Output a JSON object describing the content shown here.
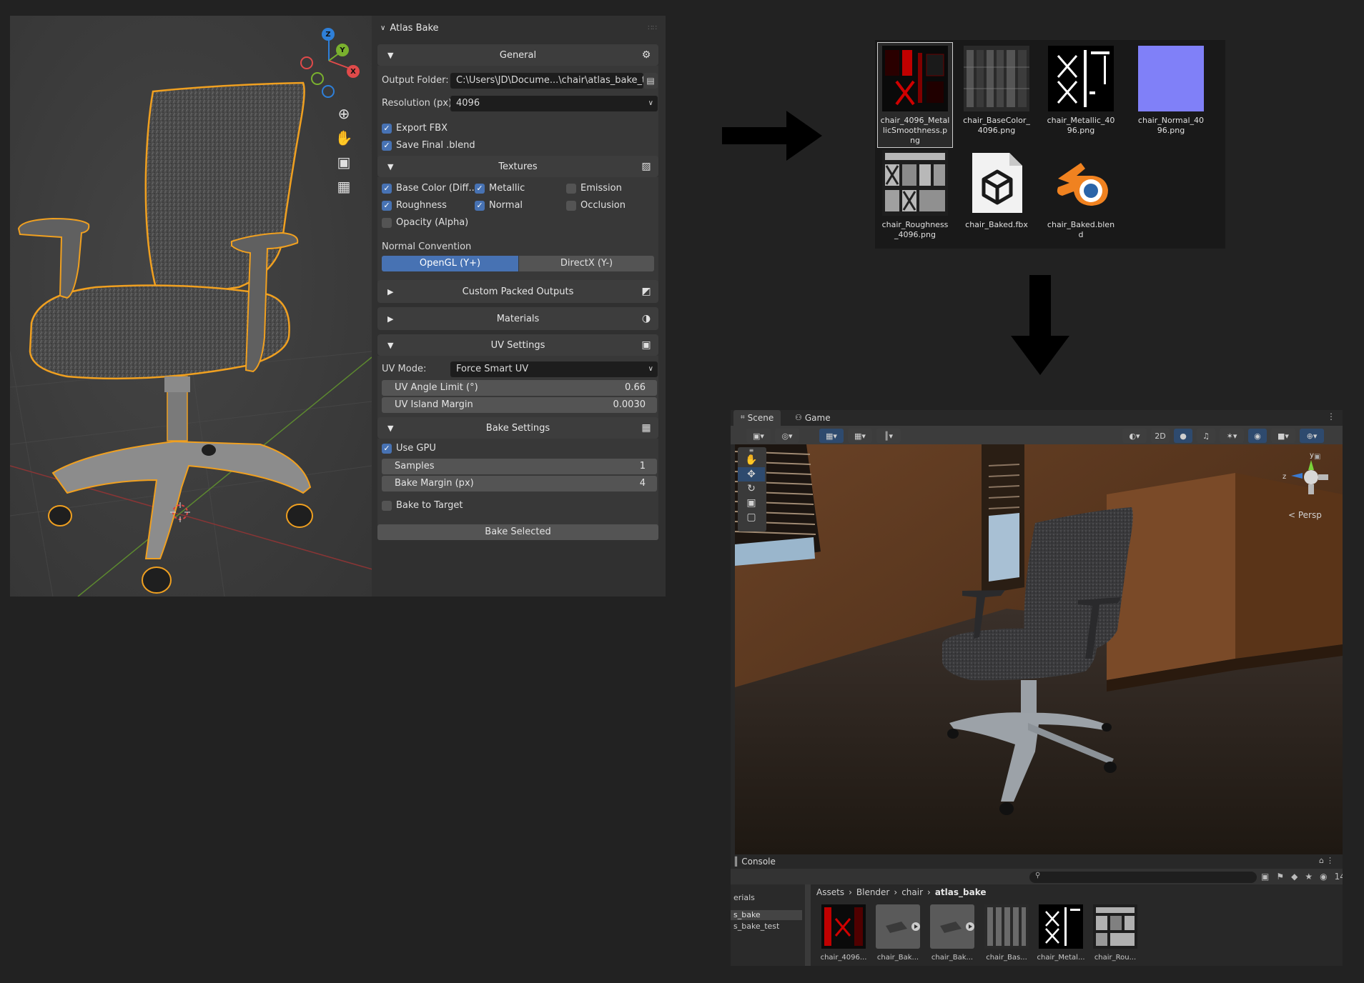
{
  "blender": {
    "panel_title": "Atlas Bake",
    "general": {
      "title": "General",
      "output_folder_label": "Output Folder:",
      "output_folder_value": "C:\\Users\\JD\\Docume...\\chair\\atlas_bake_test",
      "resolution_label": "Resolution (px):",
      "resolution_value": "4096",
      "export_fbx": "Export FBX",
      "save_final": "Save Final .blend"
    },
    "textures": {
      "title": "Textures",
      "base_color": "Base Color (Diff...",
      "metallic": "Metallic",
      "emission": "Emission",
      "roughness": "Roughness",
      "normal": "Normal",
      "occlusion": "Occlusion",
      "opacity": "Opacity (Alpha)",
      "normal_convention_label": "Normal Convention",
      "opengl": "OpenGL (Y+)",
      "directx": "DirectX (Y-)"
    },
    "custom_packed": "Custom Packed Outputs",
    "materials": "Materials",
    "uv": {
      "title": "UV Settings",
      "mode_label": "UV Mode:",
      "mode_value": "Force Smart UV",
      "angle_label": "UV Angle Limit (°)",
      "angle_value": "0.66",
      "margin_label": "UV Island Margin",
      "margin_value": "0.0030"
    },
    "bake": {
      "title": "Bake Settings",
      "use_gpu": "Use GPU",
      "samples_label": "Samples",
      "samples_value": "1",
      "margin_label": "Bake Margin (px)",
      "margin_value": "4",
      "bake_to_target": "Bake to Target",
      "bake_selected": "Bake Selected"
    },
    "gizmo": {
      "x": "X",
      "y": "Y",
      "z": "Z"
    }
  },
  "files": [
    {
      "name": "chair_4096_MetallicSmoothness.png",
      "line1": "chair_4096_Metal",
      "line2": "licSmoothness.p",
      "line3": "ng",
      "icon": "texture-metallic-smoothness"
    },
    {
      "name": "chair_BaseColor_4096.png",
      "line1": "chair_BaseColor_",
      "line2": "4096.png",
      "line3": "",
      "icon": "texture-basecolor"
    },
    {
      "name": "chair_Metallic_4096.png",
      "line1": "chair_Metallic_40",
      "line2": "96.png",
      "line3": "",
      "icon": "texture-metallic"
    },
    {
      "name": "chair_Normal_4096.png",
      "line1": "chair_Normal_40",
      "line2": "96.png",
      "line3": "",
      "icon": "texture-normal"
    },
    {
      "name": "chair_Roughness_4096.png",
      "line1": "chair_Roughness",
      "line2": "_4096.png",
      "line3": "",
      "icon": "texture-roughness"
    },
    {
      "name": "chair_Baked.fbx",
      "line1": "chair_Baked.fbx",
      "line2": "",
      "line3": "",
      "icon": "fbx-file-icon"
    },
    {
      "name": "chair_Baked.blend",
      "line1": "chair_Baked.blen",
      "line2": "d",
      "line3": "",
      "icon": "blender-file-icon"
    }
  ],
  "unity": {
    "tab_scene": "Scene",
    "tab_game": "Game",
    "btn_2d": "2D",
    "persp": "< Persp",
    "axis_y": "y",
    "axis_z": "z",
    "console": "Console",
    "badge_count": "14",
    "breadcrumb": [
      "Assets",
      "Blender",
      "chair",
      "atlas_bake"
    ],
    "tree": [
      "erials",
      "s_bake",
      "s_bake_test"
    ],
    "assets": [
      "chair_4096...",
      "chair_Bak...",
      "chair_Bak...",
      "chair_Bas...",
      "chair_Metal...",
      "chair_Rou..."
    ]
  }
}
